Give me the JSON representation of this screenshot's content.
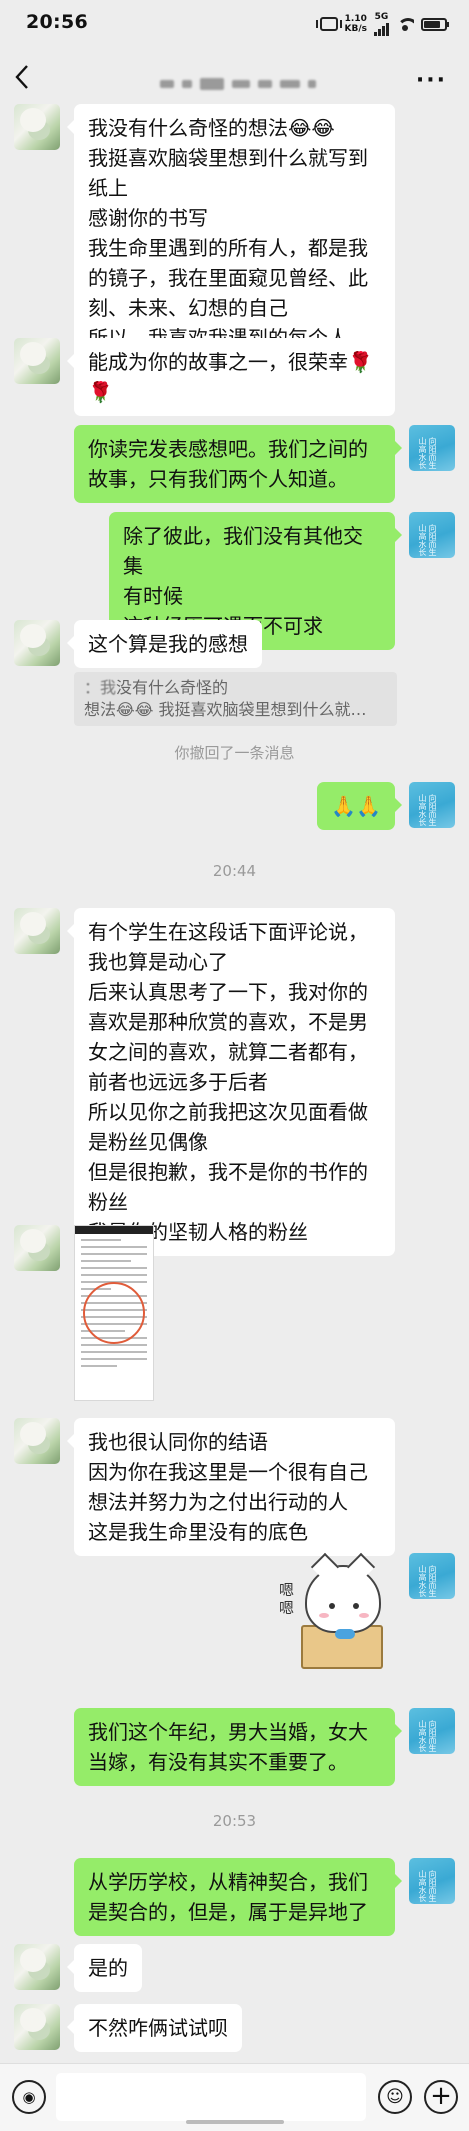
{
  "status_bar": {
    "time": "20:56",
    "speed_value": "1.10",
    "speed_unit": "KB/s",
    "network": "5G"
  },
  "header": {
    "back_icon": "chevron-left-icon",
    "more_icon": "more-dots-icon",
    "more_label": "···"
  },
  "messages": [
    {
      "side": "left",
      "lines": [
        "我没有什么奇怪的想法😂😂",
        "我挺喜欢脑袋里想到什么就写到纸上",
        "感谢你的书写",
        "我生命里遇到的所有人，都是我的镜子，我在里面窥见曾经、此刻、未来、幻想的自己",
        "所以，我喜欢我遇到的每个人"
      ]
    },
    {
      "side": "left",
      "lines": [
        "能成为你的故事之一，很荣幸🌹🌹"
      ]
    },
    {
      "side": "right",
      "lines": [
        "你读完发表感想吧。我们之间的故事，只有我们两个人知道。"
      ]
    },
    {
      "side": "right",
      "lines": [
        "除了彼此，我们没有其他交集",
        "有时候",
        "这种经历可遇而不可求"
      ]
    },
    {
      "side": "left",
      "lines": [
        "这个算是我的感想"
      ]
    },
    {
      "side": "right",
      "lines": [
        "🙏🙏"
      ]
    },
    {
      "side": "left",
      "lines": [
        "有个学生在这段话下面评论说，我也算是动心了",
        "后来认真思考了一下，我对你的喜欢是那种欣赏的喜欢，不是男女之间的喜欢，就算二者都有，前者也远远多于后者",
        "所以见你之前我把这次见面看做是粉丝见偶像",
        "但是很抱歉，我不是你的书作的粉丝",
        "我是你的坚韧人格的粉丝"
      ]
    },
    {
      "side": "left",
      "lines": [
        "我也很认同你的结语",
        "因为你在我这里是一个很有自己想法并努力为之付出行动的人",
        "这是我生命里没有的底色"
      ]
    },
    {
      "side": "right",
      "lines": [
        "我们这个年纪，男大当婚，女大当嫁，有没有其实不重要了。"
      ]
    },
    {
      "side": "right",
      "lines": [
        "从学历学校，从精神契合，我们是契合的，但是，属于是异地了"
      ]
    },
    {
      "side": "left",
      "lines": [
        "是的"
      ]
    },
    {
      "side": "left",
      "lines": [
        "不然咋俩试试呗"
      ]
    }
  ],
  "quote": {
    "line1": "没有什么奇怪的",
    "line1_blurred": "：我",
    "line2": "想法😂😂 我挺喜欢脑袋里想到什么就…"
  },
  "system": {
    "recalled": "你撤回了一条消息",
    "time1": "20:44",
    "time2": "20:53"
  },
  "avatars": {
    "me_text": "向阳而生 山高水长"
  },
  "sticker": {
    "think_text": "嗯嗯"
  },
  "bottom_bar": {
    "voice_icon": "voice-icon",
    "emoji_icon": "emoji-icon",
    "plus_icon": "plus-icon",
    "voice_glyph": "◉",
    "emoji_glyph": "☺",
    "plus_glyph": "+"
  },
  "colors": {
    "background": "#ededed",
    "bubble_me": "#95ec69",
    "bubble_other": "#ffffff"
  }
}
